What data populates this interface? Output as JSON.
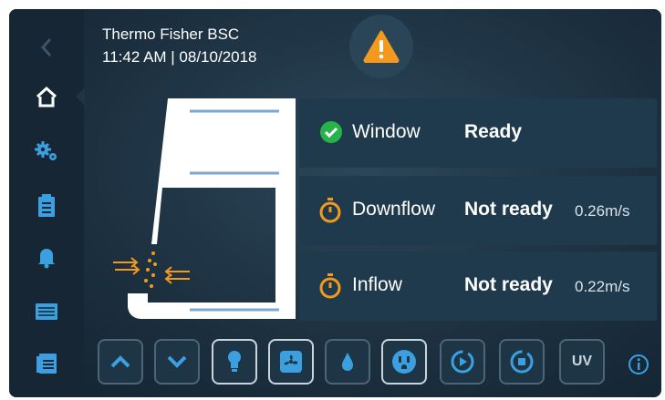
{
  "header": {
    "title": "Thermo Fisher BSC",
    "datetime": "11:42  AM | 08/10/2018"
  },
  "status": [
    {
      "name": "Window",
      "state": "Ready",
      "value": "",
      "icon": "check-circle-icon"
    },
    {
      "name": "Downflow",
      "state": "Not ready",
      "value": "0.26m/s",
      "icon": "stopwatch-icon"
    },
    {
      "name": "Inflow",
      "state": "Not ready",
      "value": "0.22m/s",
      "icon": "stopwatch-icon"
    }
  ],
  "sidebar": {
    "items": [
      "back-icon",
      "home-icon",
      "settings-icon",
      "clipboard-icon",
      "bell-icon",
      "monitor-icon",
      "calendar-icon"
    ],
    "active": "home-icon"
  },
  "toolbar": {
    "items": [
      "chevron-up-icon",
      "chevron-down-icon",
      "light-bulb-icon",
      "fan-icon",
      "drop-icon",
      "outlet-icon",
      "start-cycle-icon",
      "stop-cycle-icon",
      "uv-button",
      "info-icon"
    ],
    "uv_label": "UV"
  },
  "colors": {
    "accent": "#3b9fe0",
    "warning": "#f39a1e",
    "ok": "#27b34a",
    "panel": "#1f3a4c"
  }
}
